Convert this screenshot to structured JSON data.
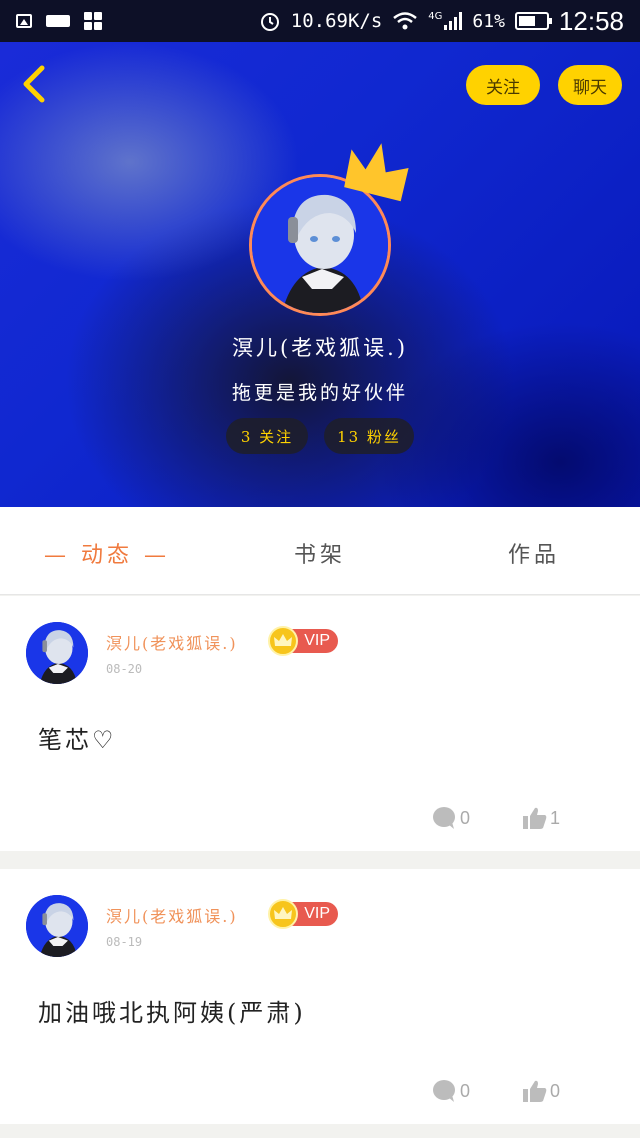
{
  "status_bar": {
    "speed": "10.69K/s",
    "network": "4G",
    "battery": "61%",
    "time": "12:58"
  },
  "header": {
    "back_icon": "chevron-left-icon",
    "follow_button": "关注",
    "chat_button": "聊天",
    "nickname": "溟儿(老戏狐误.)",
    "signature": "拖更是我的好伙伴",
    "following_count": "3 关注",
    "fans_count": "13 粉丝",
    "colors": {
      "accent": "#ffd200",
      "avatar_border": "#ff8a57"
    }
  },
  "tabs": [
    {
      "label": "— 动态 —",
      "active": true
    },
    {
      "label": "书架",
      "active": false
    },
    {
      "label": "作品",
      "active": false
    }
  ],
  "posts": [
    {
      "author": "溟儿(老戏狐误.)",
      "badge": "VIP",
      "date": "08-20",
      "content": "笔芯♡",
      "comments": "0",
      "likes": "1"
    },
    {
      "author": "溟儿(老戏狐误.)",
      "badge": "VIP",
      "date": "08-19",
      "content": "加油哦北执阿姨(严肃)",
      "comments": "0",
      "likes": "0"
    }
  ]
}
